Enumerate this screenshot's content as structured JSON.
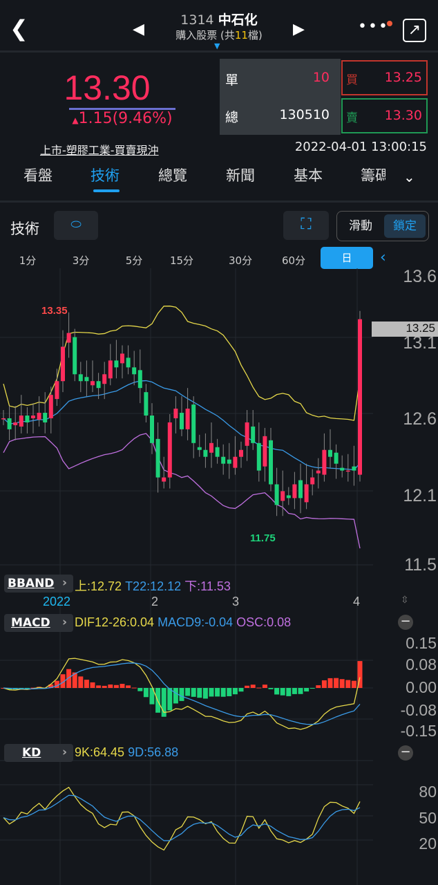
{
  "header": {
    "code": "1314",
    "name": "中石化",
    "subtitle_prefix": "購入股票 (共",
    "count": "11",
    "subtitle_suffix": "檔)"
  },
  "quote": {
    "price": "13.30",
    "change": "1.15(9.46%)",
    "single_label": "單",
    "single_value": "10",
    "total_label": "總",
    "total_value": "130510",
    "bid_label": "買",
    "bid_value": "13.25",
    "ask_label": "賣",
    "ask_value": "13.30",
    "category": "上市-塑膠工業-買賣現沖",
    "datetime": "2022-04-01 13:00:15"
  },
  "tabs": [
    "看盤",
    "技術",
    "總覽",
    "新聞",
    "基本",
    "籌碼"
  ],
  "active_tab": 1,
  "toolbar": {
    "title": "技術",
    "scroll": "滑動",
    "lock": "鎖定"
  },
  "intervals": [
    "1分",
    "3分",
    "5分",
    "15分",
    "30分",
    "60分",
    "日"
  ],
  "price_axis": [
    "13.6",
    "13.1",
    "12.6",
    "12.1",
    "11.5"
  ],
  "current_price_tag": "13.25",
  "high_label": "13.35",
  "low_label": "11.75",
  "bband": {
    "label": "BBAND",
    "upper": "上:12.72",
    "mid": "T22:12.12",
    "lower": "下:11.53"
  },
  "date_axis": [
    "2022",
    "2",
    "3",
    "4"
  ],
  "macd": {
    "label": "MACD",
    "dif": "DIF12-26:0.04",
    "macd": "MACD9:-0.04",
    "osc": "OSC:0.08",
    "axis": [
      "0.15",
      "0.08",
      "0.00",
      "-0.08",
      "-0.15"
    ]
  },
  "kd": {
    "label": "KD",
    "k": "9K:64.45",
    "d": "9D:56.88",
    "axis": [
      "80",
      "50",
      "20"
    ]
  },
  "colors": {
    "up": "#ff2d5e",
    "down": "#1dd37a",
    "yellow": "#e6d84a",
    "blue": "#3a9be8",
    "purple": "#c070e0",
    "accent": "#1fa0f0"
  },
  "closes": [
    12.58,
    12.5,
    12.55,
    12.6,
    12.55,
    12.6,
    12.62,
    12.55,
    12.75,
    12.85,
    13.1,
    13.2,
    12.9,
    12.85,
    12.85,
    12.85,
    12.8,
    12.9,
    13.0,
    12.95,
    13.05,
    12.95,
    12.9,
    12.8,
    12.6,
    12.4,
    12.15,
    12.15,
    12.55,
    12.65,
    12.5,
    12.65,
    12.4,
    12.35,
    12.3,
    12.4,
    12.3,
    12.25,
    12.25,
    12.3,
    12.35,
    12.55,
    12.4,
    12.2,
    12.45,
    12.1,
    11.95,
    12.05,
    12.0,
    12.1,
    12.0,
    12.1,
    12.15,
    12.2,
    12.35,
    12.3,
    12.25,
    12.2,
    12.2,
    12.2,
    13.3
  ]
}
